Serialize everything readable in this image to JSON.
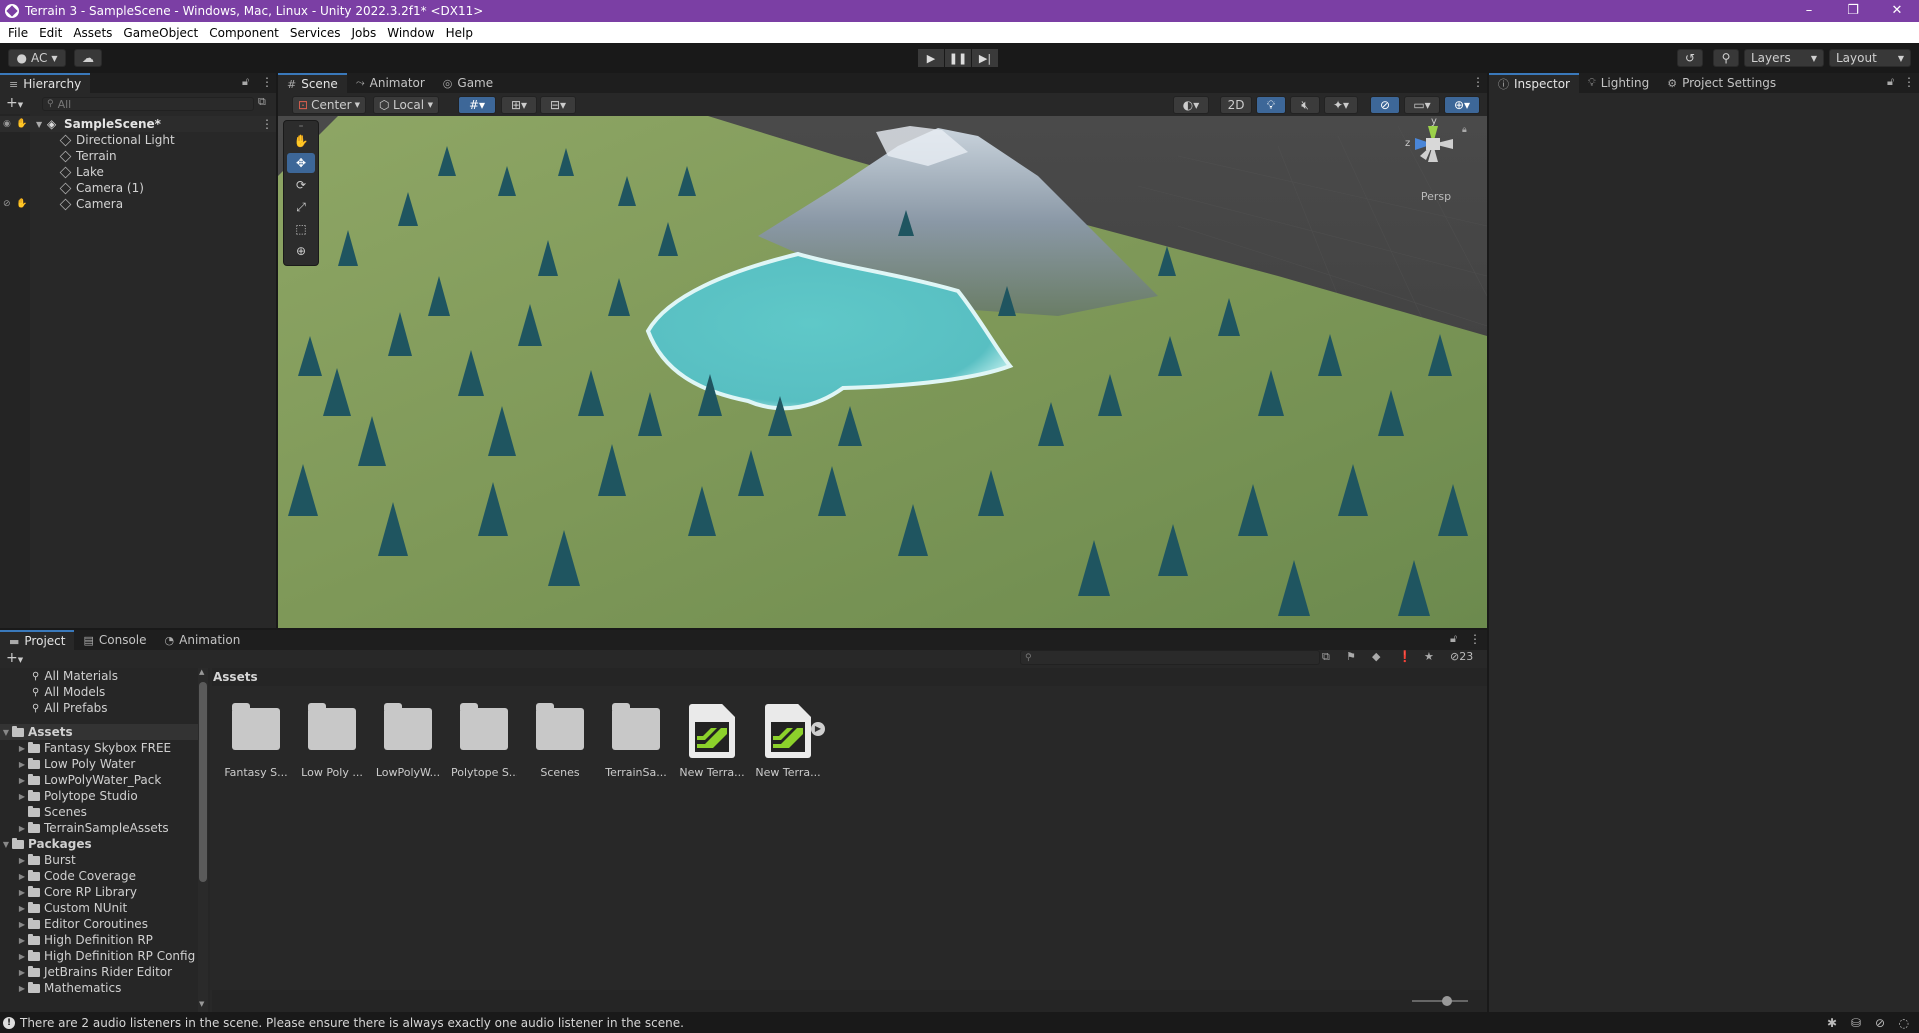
{
  "window": {
    "title": "Terrain 3 - SampleScene - Windows, Mac, Linux - Unity 2022.3.2f1* <DX11>",
    "minimize": "–",
    "restore": "❐",
    "close": "✕"
  },
  "menu": [
    "File",
    "Edit",
    "Assets",
    "GameObject",
    "Component",
    "Services",
    "Jobs",
    "Window",
    "Help"
  ],
  "toolbar": {
    "account": "AC",
    "layers": "Layers",
    "layout": "Layout"
  },
  "hierarchy": {
    "tab": "Hierarchy",
    "search_placeholder": "All",
    "scene": "SampleScene*",
    "objects": [
      "Directional Light",
      "Terrain",
      "Lake",
      "Camera (1)",
      "Camera"
    ]
  },
  "scene_view": {
    "tabs": [
      "Scene",
      "Animator",
      "Game"
    ],
    "pivot": "Center",
    "space": "Local",
    "mode_2d": "2D",
    "projection": "Persp",
    "gizmo_axes": {
      "y": "y",
      "z": "z"
    }
  },
  "inspector": {
    "tabs": [
      "Inspector",
      "Lighting",
      "Project Settings"
    ]
  },
  "project": {
    "tabs": [
      "Project",
      "Console",
      "Animation"
    ],
    "favorites": [
      "All Materials",
      "All Models",
      "All Prefabs"
    ],
    "assets_root": "Assets",
    "asset_folders": [
      "Fantasy Skybox FREE",
      "Low Poly Water",
      "LowPolyWater_Pack",
      "Polytope Studio",
      "Scenes",
      "TerrainSampleAssets"
    ],
    "packages_root": "Packages",
    "packages": [
      "Burst",
      "Code Coverage",
      "Core RP Library",
      "Custom NUnit",
      "Editor Coroutines",
      "High Definition RP",
      "High Definition RP Config",
      "JetBrains Rider Editor",
      "Mathematics"
    ],
    "breadcrumb": "Assets",
    "hidden_count": "23",
    "grid_items": [
      "Fantasy S...",
      "Low Poly ...",
      "LowPolyW...",
      "Polytope S...",
      "Scenes",
      "TerrainSa...",
      "New Terra...",
      "New Terra..."
    ]
  },
  "status": {
    "message": "There are 2 audio listeners in the scene. Please ensure there is always exactly one audio listener in the scene."
  },
  "colors": {
    "titlebar": "#7b3fa4",
    "accent": "#3a79bb",
    "lake": "#5cc6c6",
    "terrain_icon": "#8cd12b"
  }
}
